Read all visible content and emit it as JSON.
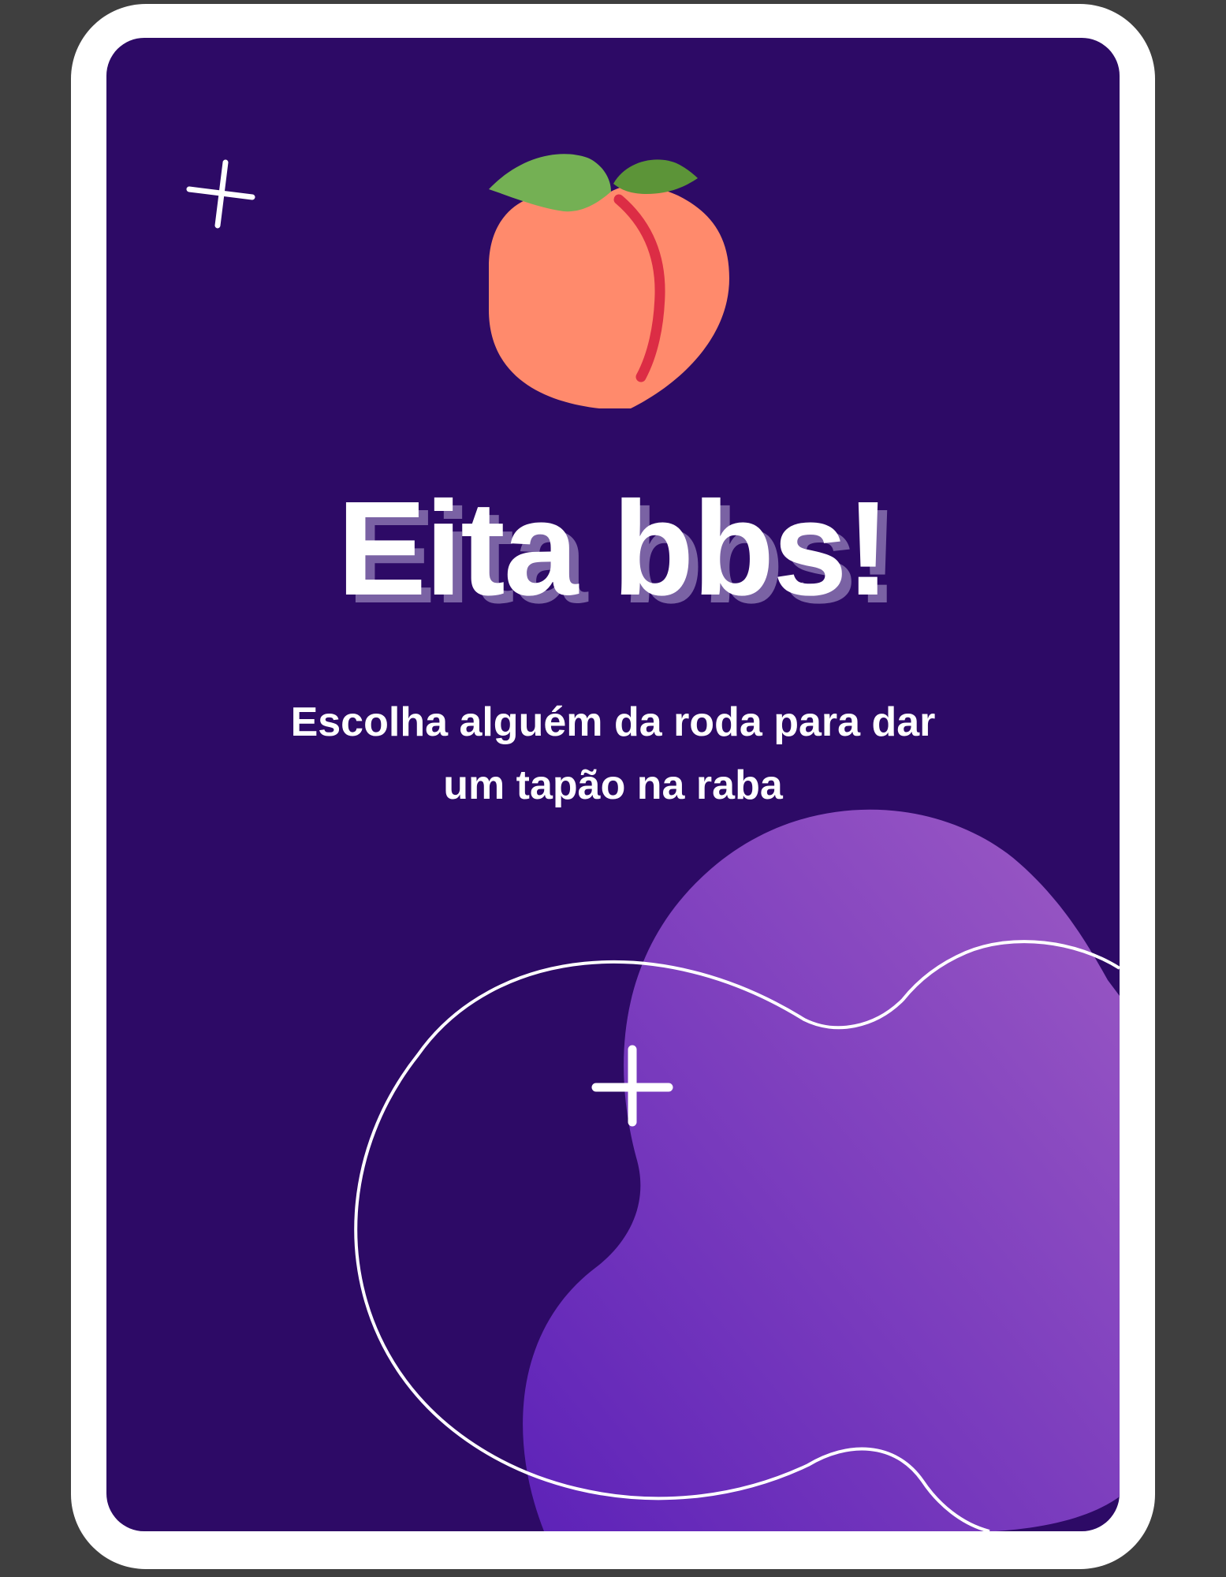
{
  "card": {
    "title": "Eita bbs!",
    "subtitle": "Escolha alguém da roda para dar um tapão na raba",
    "icon": "peach-icon",
    "decorations": [
      "sparkle-icon",
      "sparkle-icon"
    ]
  },
  "colors": {
    "page_background": "#3f3f3f",
    "card_border": "#ffffff",
    "card_background": "#2d0a66",
    "title_shadow": "#7a62a4",
    "blob_gradient_start": "#5d22b8",
    "blob_gradient_end": "#9c5ac4",
    "peach_body": "#ff8a6c",
    "peach_line": "#dc2d45",
    "leaf_left": "#74b054",
    "leaf_right": "#5c9438"
  }
}
